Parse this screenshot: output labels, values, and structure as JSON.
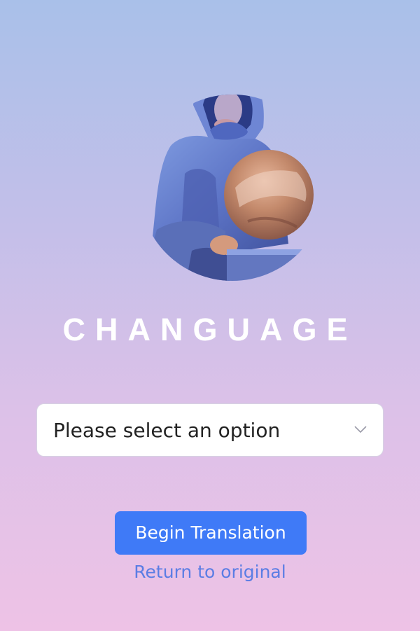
{
  "app": {
    "title": "CHANGUAGE"
  },
  "language_select": {
    "selected": "Please select an option"
  },
  "actions": {
    "begin_label": "Begin Translation",
    "return_label": "Return to original"
  },
  "colors": {
    "background_top": "#a9c0e9",
    "background_bottom": "#eec2e6",
    "primary_button": "#3f7af7",
    "link": "#5b7de4",
    "title_text": "#ffffff"
  },
  "icons": {
    "logo": "hooded-statue-with-globe-logo",
    "dropdown": "chevron-down-icon"
  }
}
